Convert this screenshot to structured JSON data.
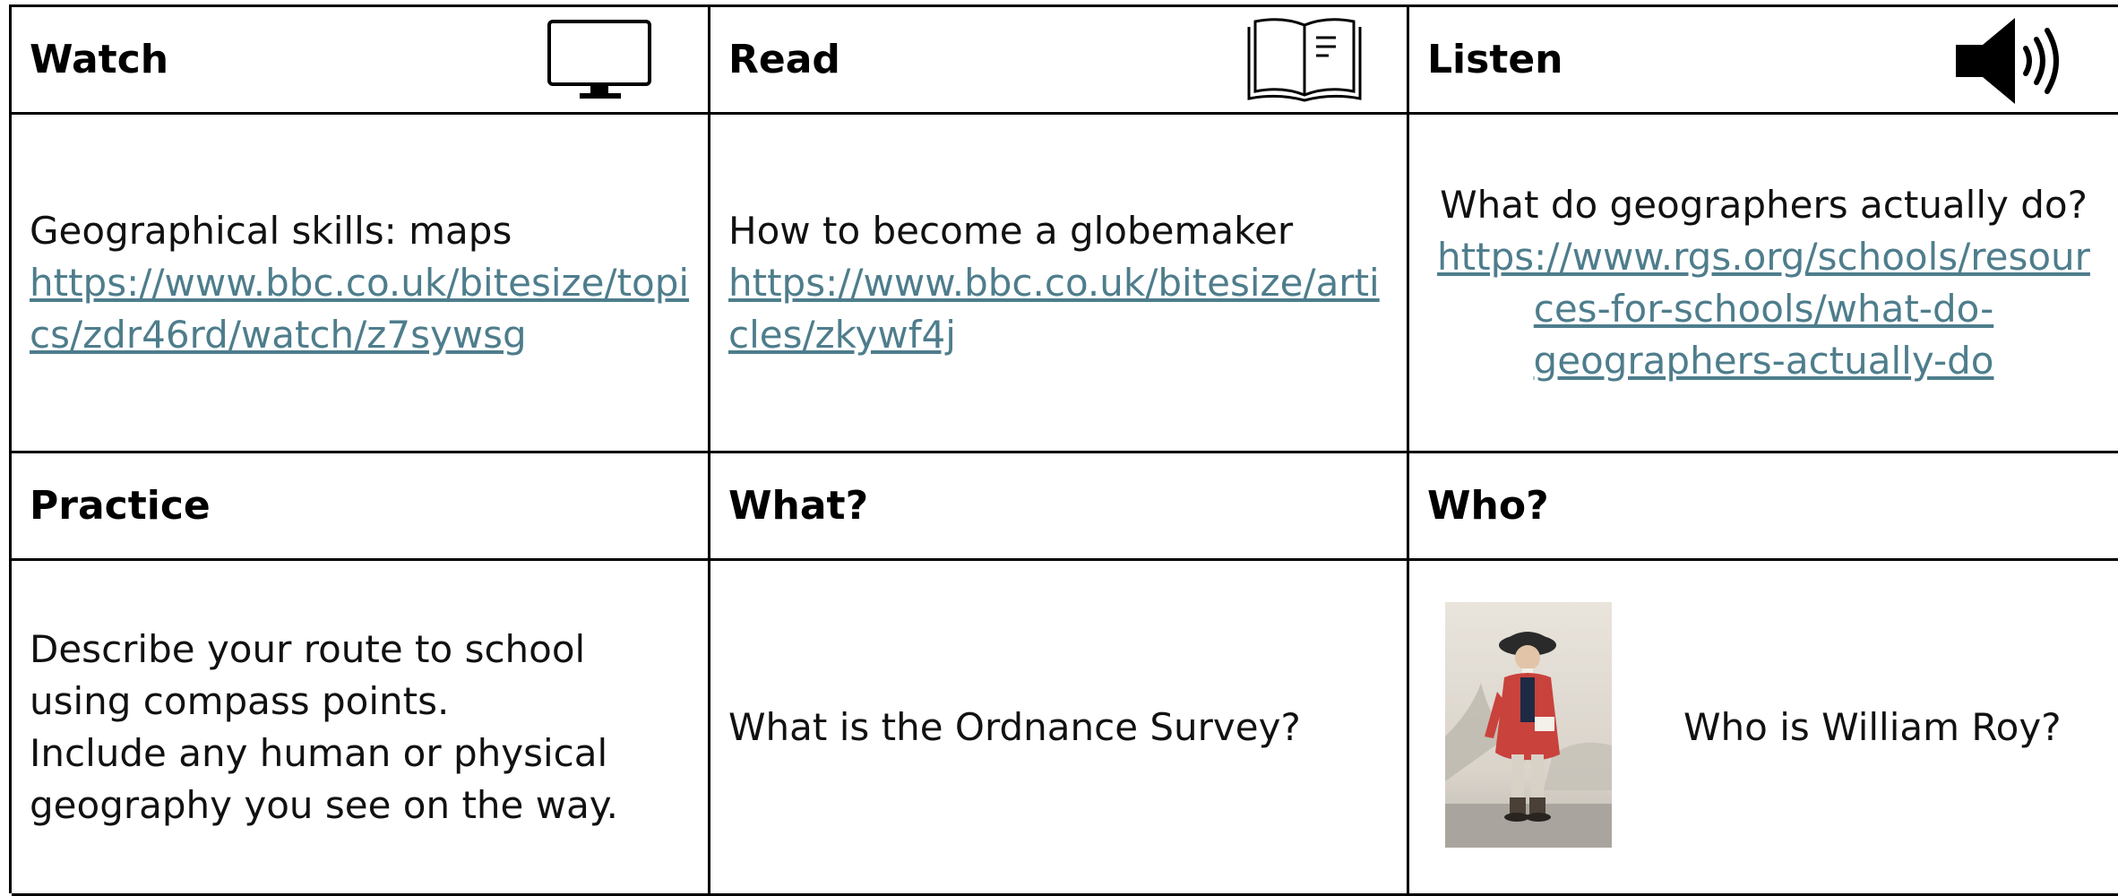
{
  "watch": {
    "heading": "Watch",
    "icon": "monitor-icon",
    "title": "Geographical skills: maps",
    "link": "https://www.bbc.co.uk/bitesize/topics/zdr46rd/watch/z7sywsg"
  },
  "read": {
    "heading": "Read",
    "icon": "open-book-icon",
    "title": "How to become a globemaker",
    "link": "https://www.bbc.co.uk/bitesize/articles/zkywf4j"
  },
  "listen": {
    "heading": "Listen",
    "icon": "speaker-icon",
    "title": "What do geographers actually do?",
    "link": "https://www.rgs.org/schools/resources-for-schools/what-do-geographers-actually-do"
  },
  "practice": {
    "heading": "Practice",
    "text_line1": "Describe your route to school using compass points.",
    "text_line2": "Include any human or physical geography you see on the way."
  },
  "what": {
    "heading": "What?",
    "text": "What is the Ordnance Survey?"
  },
  "who": {
    "heading": "Who?",
    "image": "portrait-image",
    "text": "Who is William Roy?"
  },
  "colors": {
    "link": "#4e7d8c",
    "border": "#000000",
    "text": "#111111"
  }
}
